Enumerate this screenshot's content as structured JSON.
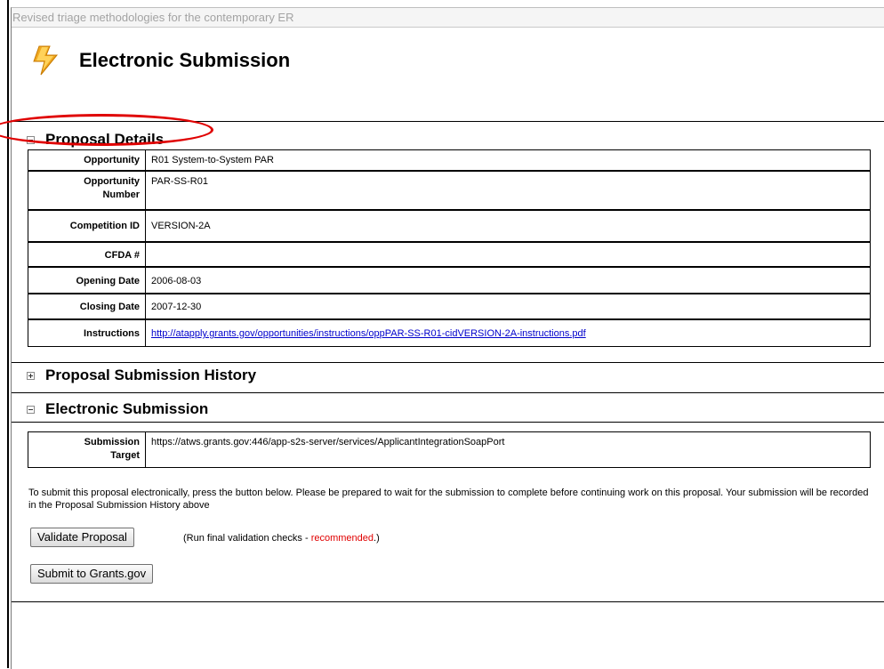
{
  "window": {
    "title": "Revised triage methodologies for the contemporary ER"
  },
  "header": {
    "title": "Electronic Submission",
    "icon": "lightning-bolt-icon"
  },
  "proposal_details": {
    "title": "Proposal Details",
    "rows": [
      {
        "label": "Opportunity",
        "value": "R01 System-to-System PAR"
      },
      {
        "label": "Opportunity Number",
        "value": "PAR-SS-R01"
      },
      {
        "label": "Competition ID",
        "value": "VERSION-2A"
      },
      {
        "label": "CFDA #",
        "value": ""
      },
      {
        "label": "Opening Date",
        "value": "2006-08-03"
      },
      {
        "label": "Closing Date",
        "value": "2007-12-30"
      },
      {
        "label": "Instructions",
        "value": "http://atapply.grants.gov/opportunities/instructions/oppPAR-SS-R01-cidVERSION-2A-instructions.pdf"
      }
    ]
  },
  "history": {
    "title": "Proposal Submission History"
  },
  "electronic_submission": {
    "title": "Electronic Submission",
    "target_label": "Submission Target",
    "target_value": "https://atws.grants.gov:446/app-s2s-server/services/ApplicantIntegrationSoapPort",
    "info_text": "To submit this proposal electronically, press the button below. Please be prepared to wait for the submission to complete before continuing work on this proposal. Your submission will be recorded in the Proposal Submission History above",
    "validate_button": "Validate Proposal",
    "validate_note_prefix": "(Run final validation checks - ",
    "validate_note_highlight": "recommended",
    "validate_note_suffix": ".)",
    "submit_button": "Submit to Grants.gov"
  },
  "colors": {
    "highlight": "#e00000",
    "link": "#0000cc"
  }
}
